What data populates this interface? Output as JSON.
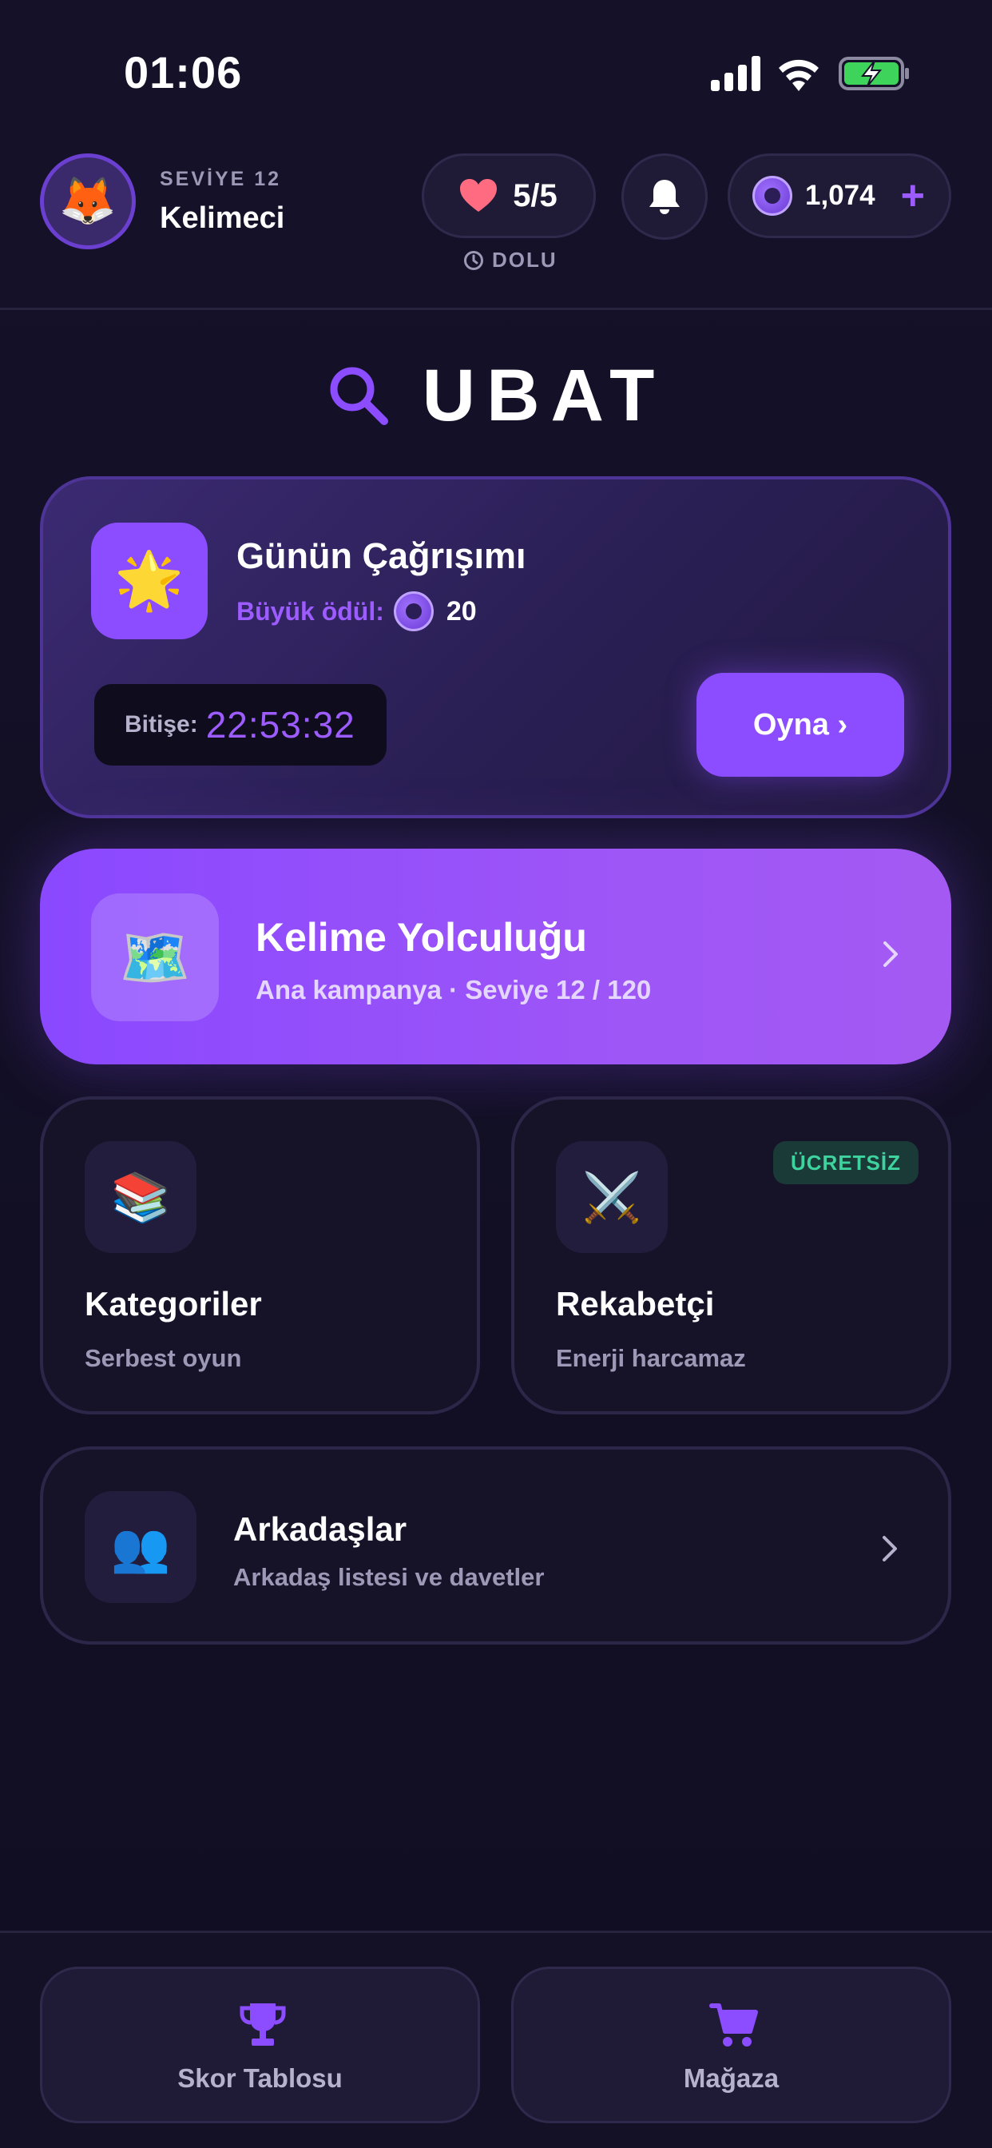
{
  "status_bar": {
    "time": "01:06"
  },
  "header": {
    "avatar_emoji": "🦊",
    "level_label": "SEVİYE 12",
    "username": "Kelimeci",
    "lives": "5/5",
    "lives_status": "DOLU",
    "coins": "1,074",
    "coins_add": "+"
  },
  "logo": {
    "title": "UBAT"
  },
  "daily_challenge": {
    "icon_emoji": "🌟",
    "title": "Günün Çağrışımı",
    "reward_label": "Büyük ödül:",
    "reward_value": "20",
    "timer_label": "Bitişe:",
    "timer_value": "22:53:32",
    "play_label": "Oyna ›"
  },
  "campaign": {
    "icon_emoji": "🗺️",
    "title": "Kelime Yolculuğu",
    "subtitle": "Ana kampanya · Seviye 12 / 120"
  },
  "modes": [
    {
      "icon_emoji": "📚",
      "title": "Kategoriler",
      "subtitle": "Serbest oyun"
    },
    {
      "icon_emoji": "⚔️",
      "title": "Rekabetçi",
      "subtitle": "Enerji harcamaz",
      "badge": "ÜCRETSİZ"
    }
  ],
  "friends": {
    "icon_emoji": "👥",
    "title": "Arkadaşlar",
    "subtitle": "Arkadaş listesi ve davetler"
  },
  "bottom_nav": [
    {
      "label": "Skor Tablosu",
      "icon": "trophy-icon"
    },
    {
      "label": "Mağaza",
      "icon": "cart-icon"
    }
  ],
  "colors": {
    "background": "#120f24",
    "accent": "#8b4dff",
    "heart": "#ff6b81",
    "free_badge": "#3ed39e",
    "battery": "#3ed35a"
  }
}
